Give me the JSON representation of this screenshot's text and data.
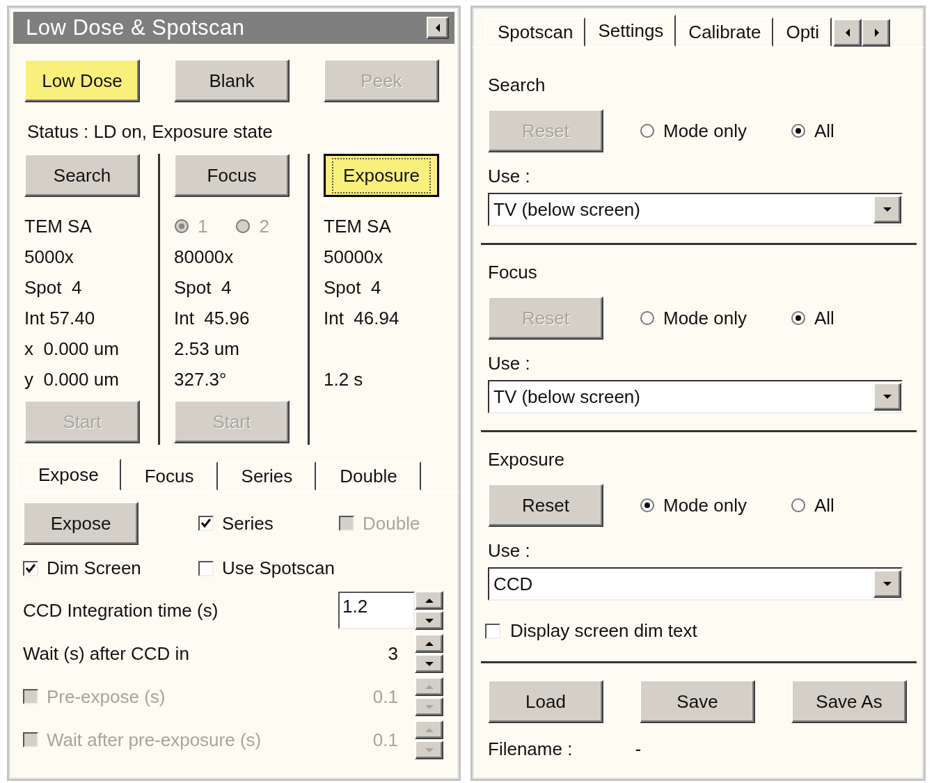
{
  "left_panel": {
    "title": "Low Dose & Spotscan",
    "top_buttons": [
      {
        "label": "Low Dose",
        "highlighted": true,
        "disabled": false
      },
      {
        "label": "Blank",
        "highlighted": false,
        "disabled": false
      },
      {
        "label": "Peek",
        "highlighted": false,
        "disabled": true
      }
    ],
    "status": "Status : LD on, Exposure state",
    "modes": [
      {
        "label": "Search",
        "highlighted": false,
        "focused": false,
        "lines": [
          "TEM SA",
          "5000x",
          "Spot  4",
          "Int 57.40",
          "x  0.000 um",
          "y  0.000 um"
        ],
        "start": {
          "label": "Start",
          "disabled": true
        }
      },
      {
        "label": "Focus",
        "highlighted": false,
        "focused": false,
        "radios": {
          "disabled": true,
          "options": [
            {
              "label": "1",
              "selected": true
            },
            {
              "label": "2",
              "selected": false
            }
          ]
        },
        "lines": [
          "80000x",
          "Spot  4",
          "Int  45.96",
          "2.53 um",
          "327.3°"
        ],
        "start": {
          "label": "Start",
          "disabled": true
        }
      },
      {
        "label": "Exposure",
        "highlighted": true,
        "focused": true,
        "lines": [
          "TEM SA",
          "50000x",
          "Spot  4",
          "Int  46.94"
        ],
        "time": "1.2 s"
      }
    ],
    "tabs": [
      {
        "label": "Expose",
        "selected": true
      },
      {
        "label": "Focus",
        "selected": false
      },
      {
        "label": "Series",
        "selected": false
      },
      {
        "label": "Double",
        "selected": false
      }
    ],
    "expose_button": "Expose",
    "checkboxes": [
      {
        "label": "Series",
        "checked": true,
        "disabled": false
      },
      {
        "label": "Double",
        "checked": false,
        "disabled": true
      },
      {
        "label": "Dim Screen",
        "checked": true,
        "disabled": false
      },
      {
        "label": "Use Spotscan",
        "checked": false,
        "disabled": false
      }
    ],
    "spinners": [
      {
        "label": "CCD Integration time (s)",
        "value": "1.2",
        "kind": "input",
        "disabled": false
      },
      {
        "label": "Wait (s) after CCD in",
        "value": "3",
        "kind": "text",
        "disabled": false
      },
      {
        "label": "Pre-expose (s)",
        "value": "0.1",
        "kind": "checkbox",
        "checked": false,
        "disabled": true
      },
      {
        "label": "Wait after pre-exposure (s)",
        "value": "0.1",
        "kind": "checkbox",
        "checked": false,
        "disabled": true
      }
    ]
  },
  "right_panel": {
    "tabs": [
      {
        "label": "Spotscan",
        "selected": false
      },
      {
        "label": "Settings",
        "selected": true
      },
      {
        "label": "Calibrate",
        "selected": false
      },
      {
        "label": "Opti",
        "selected": false
      }
    ],
    "sections": [
      {
        "heading": "Search",
        "reset": {
          "label": "Reset",
          "disabled": true
        },
        "options": [
          {
            "label": "Mode only",
            "selected": false
          },
          {
            "label": "All",
            "selected": true
          }
        ],
        "use_label": "Use :",
        "use_value": "TV (below screen)"
      },
      {
        "heading": "Focus",
        "reset": {
          "label": "Reset",
          "disabled": true
        },
        "options": [
          {
            "label": "Mode only",
            "selected": false
          },
          {
            "label": "All",
            "selected": true
          }
        ],
        "use_label": "Use :",
        "use_value": "TV (below screen)"
      },
      {
        "heading": "Exposure",
        "reset": {
          "label": "Reset",
          "disabled": false
        },
        "options": [
          {
            "label": "Mode only",
            "selected": true
          },
          {
            "label": "All",
            "selected": false
          }
        ],
        "use_label": "Use :",
        "use_value": "CCD",
        "checkbox": {
          "label": "Display screen dim text",
          "checked": false
        }
      }
    ],
    "buttons": [
      "Load",
      "Save",
      "Save As"
    ],
    "filename_label": "Filename :",
    "filename_value": "-"
  }
}
